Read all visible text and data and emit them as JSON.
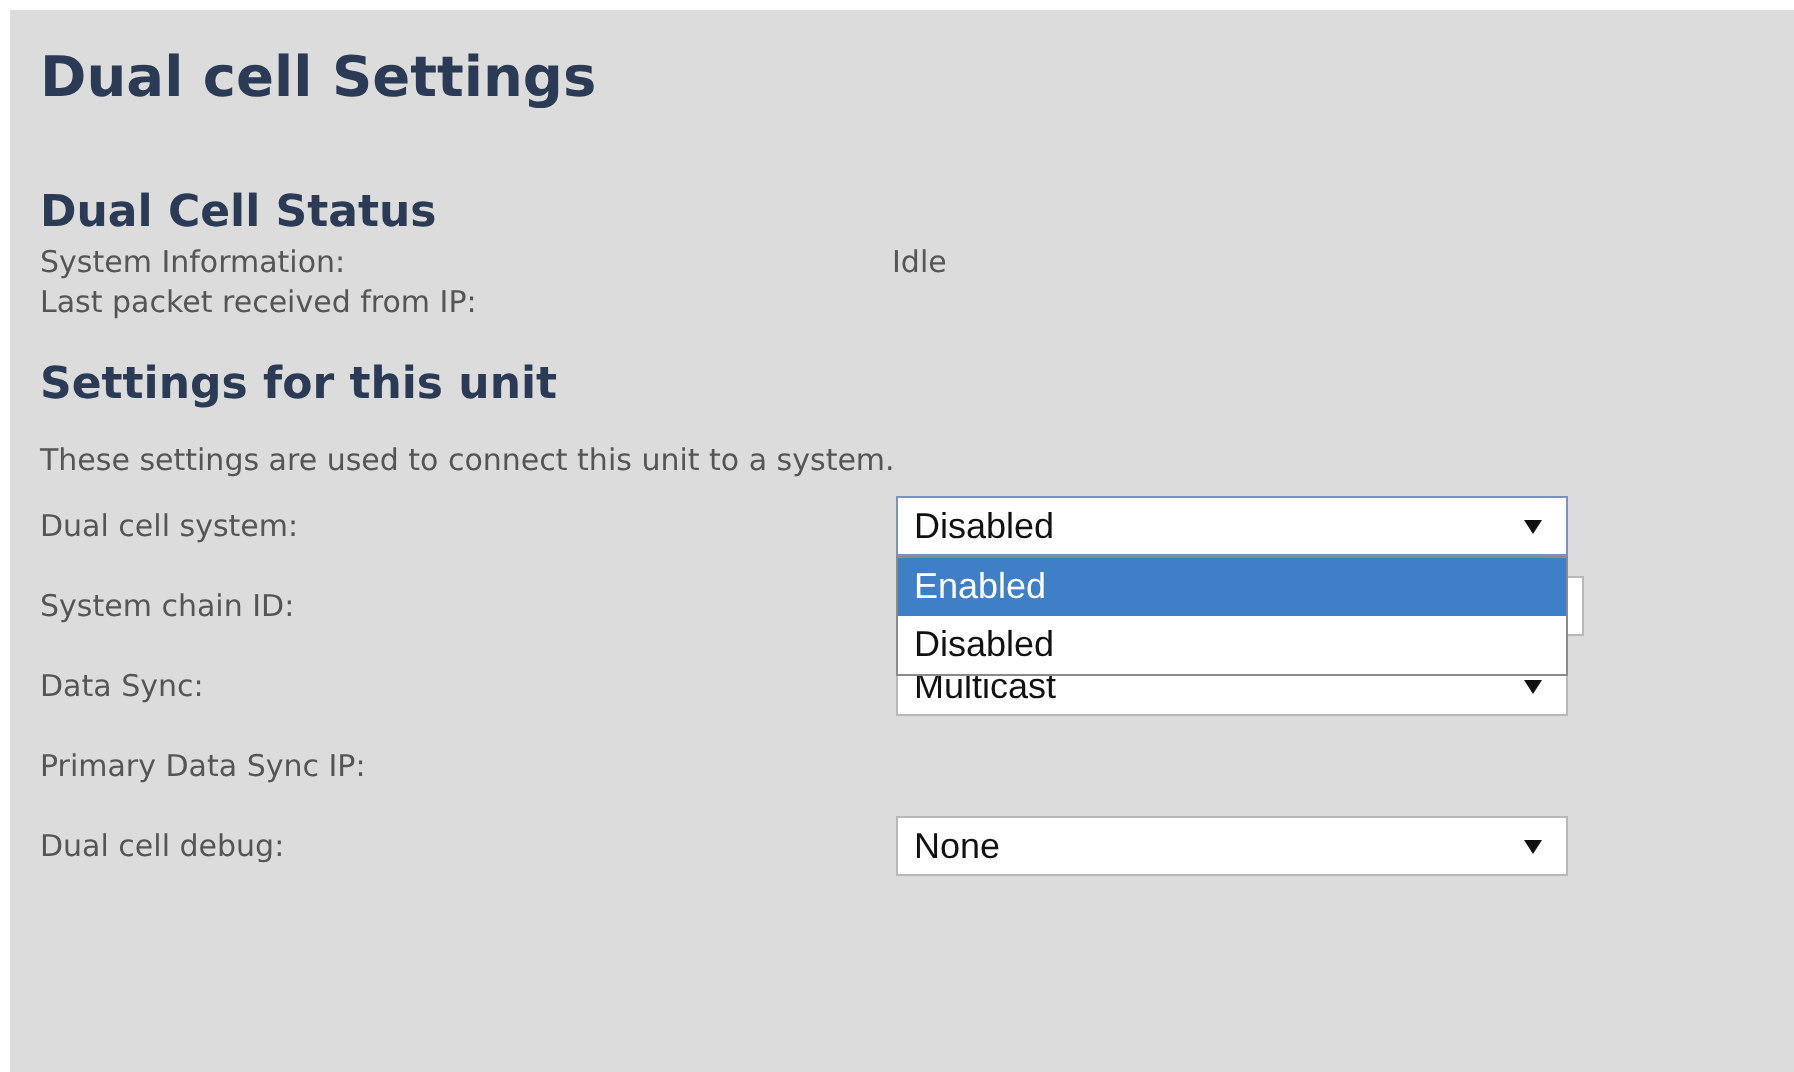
{
  "title": "Dual cell Settings",
  "status": {
    "heading": "Dual Cell Status",
    "rows": [
      {
        "label": "System Information:",
        "value": "Idle"
      },
      {
        "label": "Last packet received from IP:"
      }
    ]
  },
  "settings": {
    "heading": "Settings for this unit",
    "description": "These settings are used to connect this unit to a system.",
    "fields": [
      {
        "label": "Dual cell system:",
        "kind": "select",
        "value": "Disabled",
        "expanded": true,
        "options": [
          {
            "label": "Enabled",
            "highlighted": true
          },
          {
            "label": "Disabled",
            "highlighted": false
          }
        ]
      },
      {
        "label": "System chain ID:",
        "kind": "text"
      },
      {
        "label": "Data Sync:",
        "kind": "select",
        "value": "Multicast",
        "expanded": false
      },
      {
        "label": "Primary Data Sync IP:",
        "kind": "none"
      },
      {
        "label": "Dual cell debug:",
        "kind": "select",
        "value": "None",
        "expanded": false
      }
    ]
  }
}
